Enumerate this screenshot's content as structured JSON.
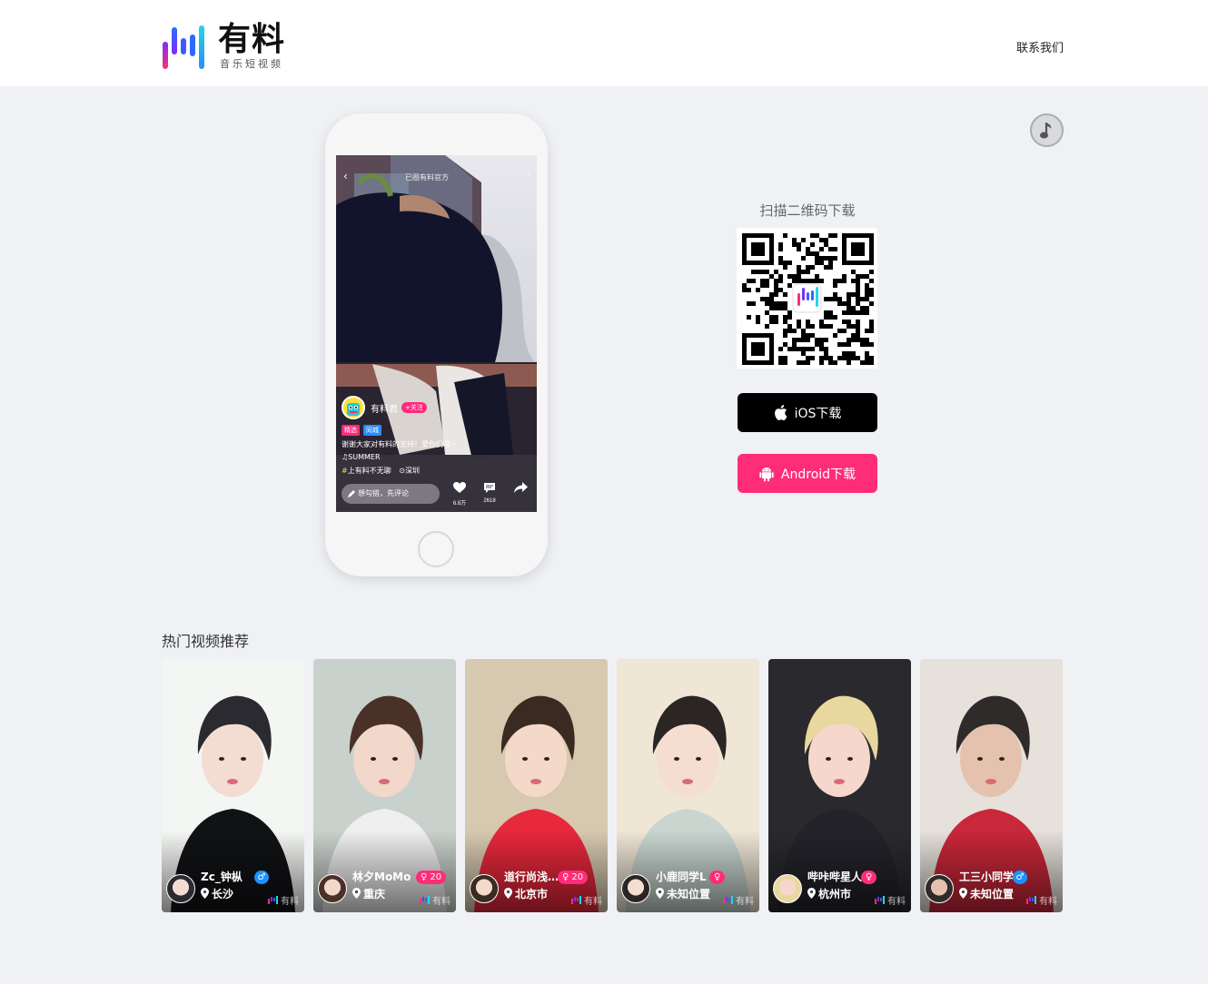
{
  "header": {
    "logo_title": "有料",
    "logo_subtitle": "音乐短视频",
    "contact_label": "联系我们"
  },
  "music_button": {
    "icon": "music-note-icon"
  },
  "phone_preview": {
    "back_icon": "‹",
    "channel": "已圈有料官方",
    "more_icon": "···",
    "author": "有料君",
    "follow_label": "+关注",
    "tags": [
      {
        "label": "精选",
        "color": "#ff2b7d"
      },
      {
        "label": "同城",
        "color": "#2a8cff"
      }
    ],
    "caption": "谢谢大家对有料的支持！爱你们哦~",
    "music": "SUMMER",
    "topic": "上有料不无聊",
    "location": "深圳",
    "comment_placeholder": "想勾搭，先评论",
    "likes": "6.8万",
    "comments": "2618"
  },
  "download": {
    "scan_title": "扫描二维码下载",
    "ios_label": "iOS下载",
    "android_label": "Android下载",
    "ios_color": "#000000",
    "android_color": "#ff2d78"
  },
  "hot": {
    "title": "热门视频推荐",
    "watermark": "有料",
    "videos": [
      {
        "name": "Zc_钟枞",
        "gender": "male",
        "badge": "♂",
        "location": "长沙"
      },
      {
        "name": "林夕MoMo",
        "gender": "female",
        "badge": "20",
        "location": "重庆"
      },
      {
        "name": "道行尚浅…",
        "gender": "female",
        "badge": "20",
        "location": "北京市"
      },
      {
        "name": "小鹿同学L",
        "gender": "female",
        "badge": "",
        "location": "未知位置"
      },
      {
        "name": "哔咔哔星人",
        "gender": "female",
        "badge": "",
        "location": "杭州市"
      },
      {
        "name": "工三小同学",
        "gender": "male",
        "badge": "♂",
        "location": "未知位置"
      }
    ]
  },
  "colors": {
    "brand_pink": "#ff2d78",
    "male_blue": "#1e90ff",
    "female_pink": "#ff2d78",
    "page_bg": "#eff1f4"
  }
}
